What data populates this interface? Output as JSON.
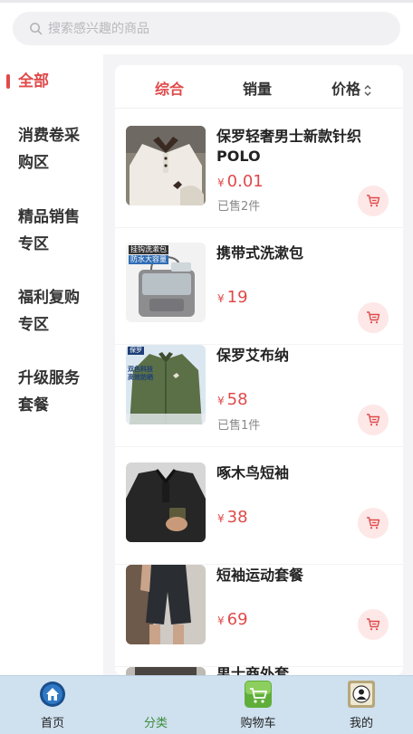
{
  "search": {
    "placeholder": "搜索感兴趣的商品"
  },
  "sidebar": {
    "items": [
      {
        "label": "全部"
      },
      {
        "line1": "消费卷采",
        "line2": "购区"
      },
      {
        "line1": "精品销售",
        "line2": "专区"
      },
      {
        "line1": "福利复购",
        "line2": "专区"
      },
      {
        "line1": "升级服务",
        "line2": "套餐"
      }
    ]
  },
  "sort_tabs": {
    "comprehensive": "综合",
    "sales": "销量",
    "price": "价格"
  },
  "currency_symbol": "¥",
  "products": [
    {
      "title": "保罗轻奢男士新款针织POLO",
      "price": "0.01",
      "sold": "已售2件",
      "image": "polo-shirt-photo"
    },
    {
      "title": "携带式洗漱包",
      "price": "19",
      "sold": "",
      "image": "toiletry-bag-photo",
      "image_text_1": "挂钩洗漱包",
      "image_text_2": "防水大容量"
    },
    {
      "title": "保罗艾布纳",
      "price": "58",
      "sold": "已售1件",
      "image": "green-jacket-photo",
      "image_text_1": "保罗",
      "image_text_2": "双色科技",
      "image_text_3": "高效防晒"
    },
    {
      "title": "啄木鸟短袖",
      "price": "38",
      "sold": "",
      "image": "black-polo-photo"
    },
    {
      "title": "短袖运动套餐",
      "price": "69",
      "sold": "",
      "image": "sport-shorts-photo"
    },
    {
      "title": "男士商外套",
      "price": "",
      "sold": "",
      "image": "jacket-photo"
    }
  ],
  "tabbar": {
    "home": "首页",
    "category": "分类",
    "cart": "购物车",
    "mine": "我的"
  },
  "colors": {
    "accent": "#e04a4a",
    "tabbar_bg": "#cfe0ef",
    "active_tab_label": "#3b8d3b"
  }
}
